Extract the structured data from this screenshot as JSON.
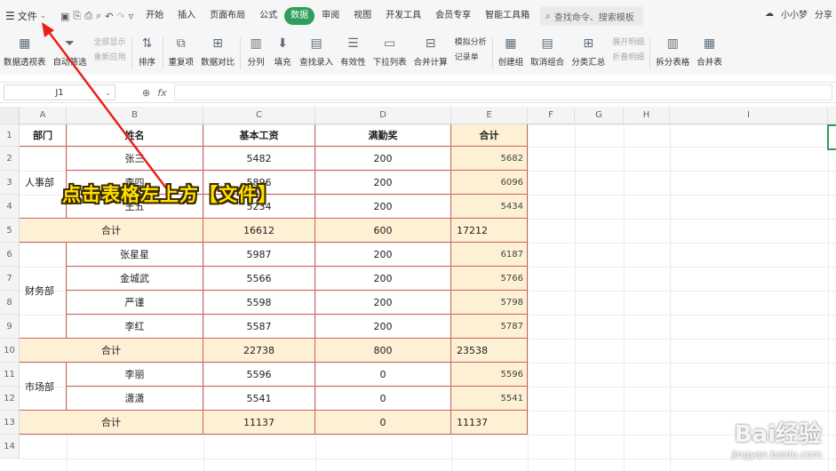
{
  "menubar": {
    "file_label": "文件",
    "tabs": [
      {
        "label": "开始",
        "active": false
      },
      {
        "label": "插入",
        "active": false
      },
      {
        "label": "页面布局",
        "active": false
      },
      {
        "label": "公式",
        "active": false
      },
      {
        "label": "数据",
        "active": true
      },
      {
        "label": "审阅",
        "active": false
      },
      {
        "label": "视图",
        "active": false
      },
      {
        "label": "开发工具",
        "active": false
      },
      {
        "label": "会员专享",
        "active": false
      },
      {
        "label": "智能工具箱",
        "active": false
      }
    ],
    "search_placeholder": "查找命令、搜索模板",
    "user_label": "小小梦",
    "share_label": "分享"
  },
  "ribbon": {
    "buttons": [
      {
        "label": "数据透视表",
        "icon": "pivot-table-icon"
      },
      {
        "label": "自动筛选",
        "icon": "filter-icon"
      },
      {
        "label": "排序",
        "icon": "sort-icon"
      },
      {
        "label": "重复项",
        "icon": "duplicates-icon"
      },
      {
        "label": "数据对比",
        "icon": "compare-icon"
      },
      {
        "label": "分列",
        "icon": "split-column-icon"
      },
      {
        "label": "填充",
        "icon": "fill-icon"
      },
      {
        "label": "查找录入",
        "icon": "lookup-entry-icon"
      },
      {
        "label": "有效性",
        "icon": "validation-icon"
      },
      {
        "label": "下拉列表",
        "icon": "dropdown-list-icon"
      },
      {
        "label": "合并计算",
        "icon": "consolidate-icon"
      },
      {
        "label": "创建组",
        "icon": "group-icon"
      },
      {
        "label": "取消组合",
        "icon": "ungroup-icon"
      },
      {
        "label": "分类汇总",
        "icon": "subtotal-icon"
      },
      {
        "label": "拆分表格",
        "icon": "split-table-icon"
      },
      {
        "label": "合并表",
        "icon": "merge-table-icon"
      }
    ],
    "filter_small": [
      "全部显示",
      "重新应用"
    ],
    "model_small": [
      "模拟分析",
      "记录单"
    ],
    "outline_small": [
      "展开明细",
      "折叠明细"
    ]
  },
  "formula_bar": {
    "cell_ref": "J1",
    "fx_label": "fx",
    "formula": ""
  },
  "grid": {
    "columns": [
      "A",
      "B",
      "C",
      "D",
      "E",
      "F",
      "G",
      "H",
      "I"
    ],
    "rows": [
      "1",
      "2",
      "3",
      "4",
      "5",
      "6",
      "7",
      "8",
      "9",
      "10",
      "11",
      "12",
      "13",
      "14"
    ]
  },
  "table": {
    "headers": {
      "dept": "部门",
      "name": "姓名",
      "base": "基本工资",
      "bonus": "满勤奖",
      "total": "合计"
    },
    "groups": [
      {
        "dept": "人事部",
        "rows": [
          {
            "name": "张三",
            "base": "5482",
            "bonus": "200",
            "total": "5682"
          },
          {
            "name": "李四",
            "base": "5896",
            "bonus": "200",
            "total": "6096"
          },
          {
            "name": "王五",
            "base": "5234",
            "bonus": "200",
            "total": "5434"
          }
        ],
        "subtotal": {
          "label": "合计",
          "base": "16612",
          "bonus": "600",
          "total": "17212"
        }
      },
      {
        "dept": "财务部",
        "rows": [
          {
            "name": "张星星",
            "base": "5987",
            "bonus": "200",
            "total": "6187"
          },
          {
            "name": "金城武",
            "base": "5566",
            "bonus": "200",
            "total": "5766"
          },
          {
            "name": "严谨",
            "base": "5598",
            "bonus": "200",
            "total": "5798"
          },
          {
            "name": "李红",
            "base": "5587",
            "bonus": "200",
            "total": "5787"
          }
        ],
        "subtotal": {
          "label": "合计",
          "base": "22738",
          "bonus": "800",
          "total": "23538"
        }
      },
      {
        "dept": "市场部",
        "rows": [
          {
            "name": "李丽",
            "base": "5596",
            "bonus": "0",
            "total": "5596"
          },
          {
            "name": "潇潇",
            "base": "5541",
            "bonus": "0",
            "total": "5541"
          }
        ],
        "subtotal": {
          "label": "合计",
          "base": "11137",
          "bonus": "0",
          "total": "11137"
        }
      }
    ]
  },
  "annotation": {
    "text": "点击表格左上方【文件】"
  },
  "watermark": {
    "brand": "Bai经验",
    "url": "jingyan.baidu.com"
  },
  "colors": {
    "accent_green": "#2f9e5d",
    "table_border": "#c9655a",
    "subtotal_fill": "#fdf0d5",
    "arrow_red": "#e8211d",
    "annotation_yellow": "#ffe100"
  }
}
